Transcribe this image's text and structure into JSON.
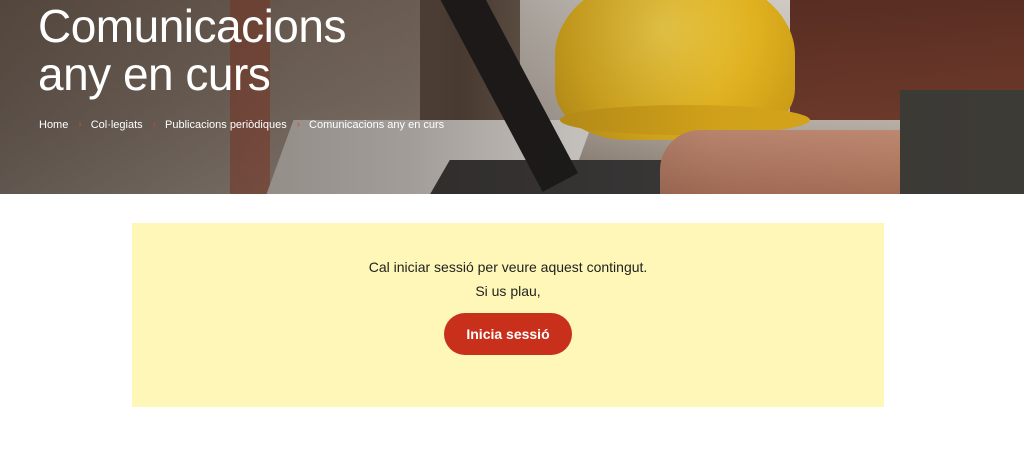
{
  "hero": {
    "title_line1": "Comunicacions",
    "title_line2": "any en curs"
  },
  "breadcrumb": {
    "items": [
      "Home",
      "Col·legiats",
      "Publicacions periòdiques",
      "Comunicacions any en curs"
    ],
    "separator": "›"
  },
  "notice": {
    "line1": "Cal iniciar sessió per veure aquest contingut.",
    "line2": "Si us plau,",
    "button_label": "Inicia sessió",
    "background": "#fff7b7",
    "button_color": "#c8301b"
  }
}
